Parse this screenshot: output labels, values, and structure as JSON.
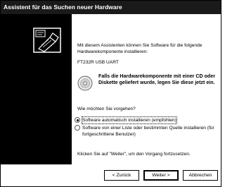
{
  "window": {
    "title": "Assistent für das Suchen neuer Hardware"
  },
  "content": {
    "intro": "Mit diesem Assistenten können Sie Software für die folgende Hardwarekomponente installieren:",
    "device_name": "FT232R USB UART",
    "cd_notice": "Falls die Hardwarekomponente mit einer CD oder Diskette geliefert wurde, legen Sie diese jetzt ein.",
    "question": "Wie möchten Sie vorgehen?",
    "options": [
      {
        "label": "Software automatisch installieren (empfohlen)",
        "selected": true
      },
      {
        "label": "Software von einer Liste oder bestimmten Quelle installieren (für fortgeschrittene Benutzer)",
        "selected": false
      }
    ],
    "continue_hint": "Klicken Sie auf \"Weiter\", um den Vorgang fortzusetzen."
  },
  "buttons": {
    "back": "< Zurück",
    "next": "Weiter >",
    "cancel": "Abbrechen"
  },
  "icons": {
    "wizard": "hardware-wizard-icon",
    "cd": "cd-disc-icon"
  }
}
